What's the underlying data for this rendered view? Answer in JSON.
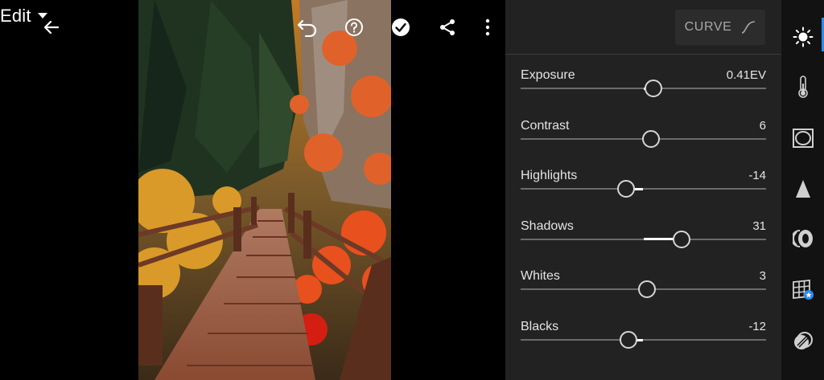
{
  "toolbar": {
    "mode_label": "Edit",
    "icons": {
      "back": "back-arrow-icon",
      "mode_dropdown": "caret-down-icon",
      "undo": "undo-icon",
      "help": "help-icon",
      "done": "checkmark-icon",
      "share": "share-icon",
      "more": "more-vertical-icon"
    }
  },
  "panel": {
    "curve_label": "CURVE",
    "curve_icon": "curve-icon",
    "sliders": [
      {
        "label": "Exposure",
        "value_text": "0.41EV",
        "value": 0.41,
        "min": -5,
        "max": 5
      },
      {
        "label": "Contrast",
        "value_text": "6",
        "value": 6,
        "min": -100,
        "max": 100
      },
      {
        "label": "Highlights",
        "value_text": "-14",
        "value": -14,
        "min": -100,
        "max": 100
      },
      {
        "label": "Shadows",
        "value_text": "31",
        "value": 31,
        "min": -100,
        "max": 100
      },
      {
        "label": "Whites",
        "value_text": "3",
        "value": 3,
        "min": -100,
        "max": 100
      },
      {
        "label": "Blacks",
        "value_text": "-12",
        "value": -12,
        "min": -100,
        "max": 100
      }
    ]
  },
  "rail": {
    "items": [
      {
        "name": "light",
        "icon": "sun-icon",
        "active": true
      },
      {
        "name": "color",
        "icon": "thermometer-icon",
        "active": false
      },
      {
        "name": "effects",
        "icon": "vignette-icon",
        "active": false
      },
      {
        "name": "detail",
        "icon": "triangle-icon",
        "active": false
      },
      {
        "name": "optics",
        "icon": "lens-icon",
        "active": false
      },
      {
        "name": "geometry",
        "icon": "grid-icon",
        "active": false
      },
      {
        "name": "presets",
        "icon": "circles-icon",
        "active": false
      }
    ]
  },
  "colors": {
    "panel_bg": "#222222",
    "rail_bg": "#121212",
    "accent": "#2d8cf0",
    "track": "#6b6b6b"
  }
}
